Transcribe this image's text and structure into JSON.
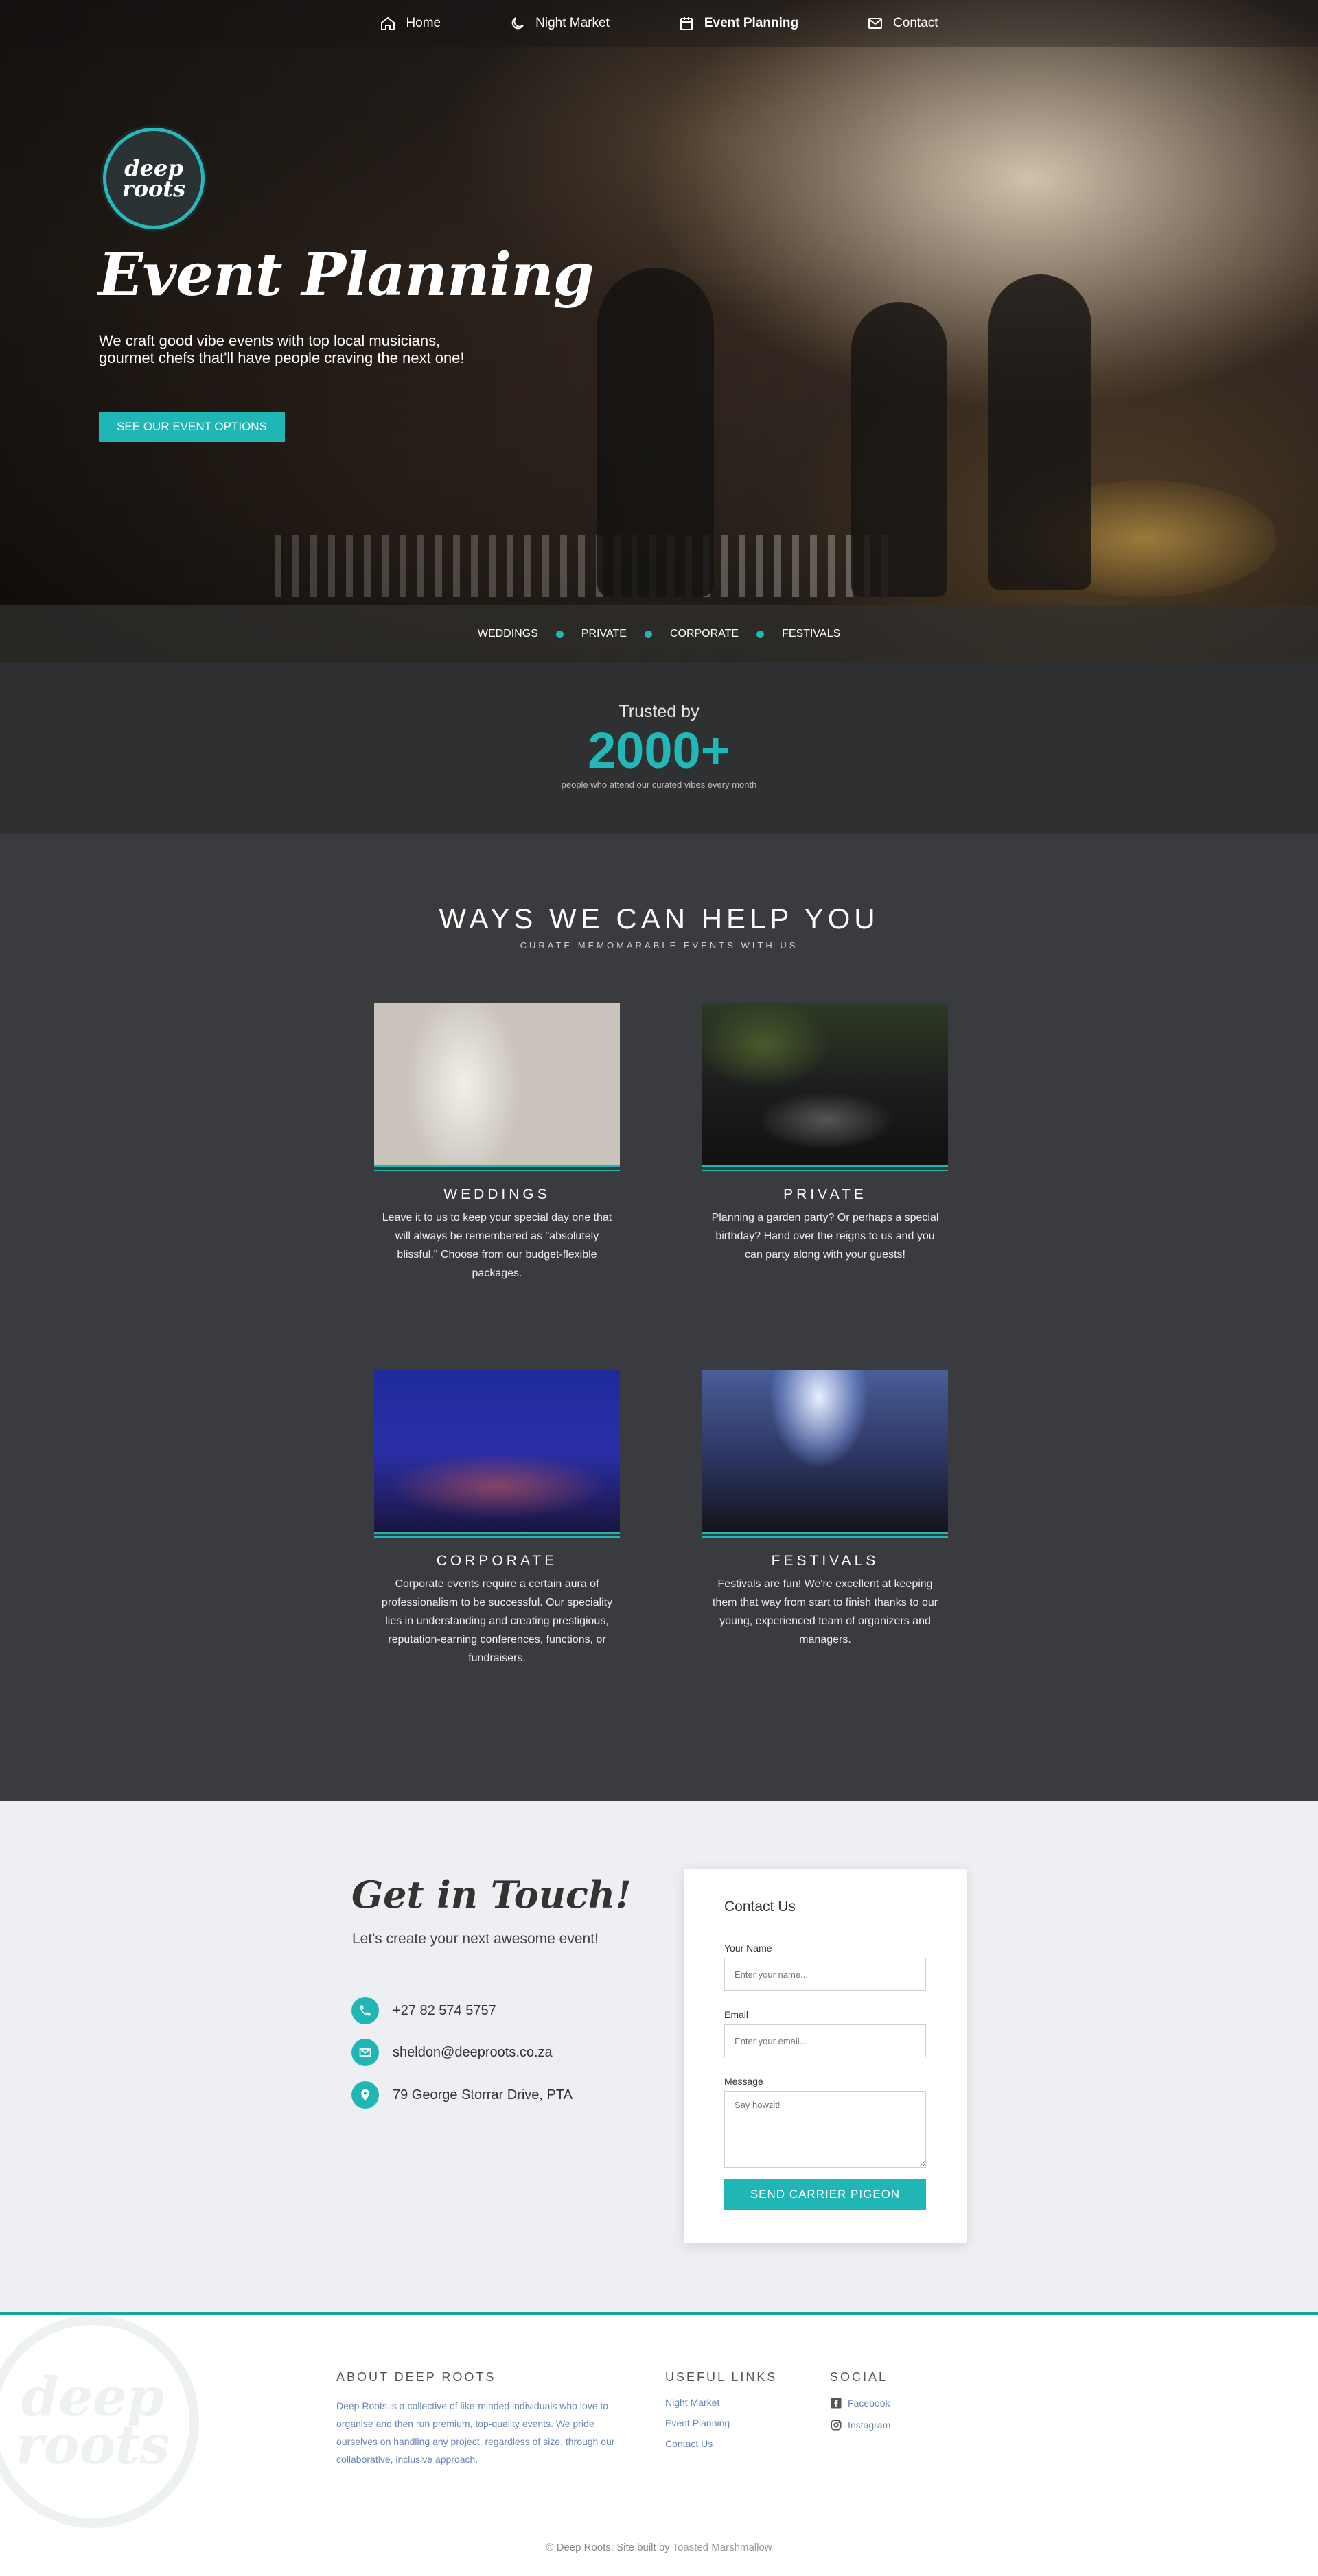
{
  "nav": {
    "items": [
      {
        "label": "Home"
      },
      {
        "label": "Night Market"
      },
      {
        "label": "Event Planning"
      },
      {
        "label": "Contact"
      }
    ]
  },
  "hero": {
    "logo_line1": "deep",
    "logo_line2": "roots",
    "title": "Event Planning",
    "subtitle": "We craft good vibe events with top local musicians, gourmet chefs that'll have people craving the next one!",
    "cta": "SEE OUR EVENT OPTIONS",
    "categories": [
      "WEDDINGS",
      "PRIVATE",
      "CORPORATE",
      "FESTIVALS"
    ]
  },
  "trusted": {
    "label": "Trusted by",
    "count": "2000+",
    "caption": "people who attend our curated vibes every month"
  },
  "ways": {
    "title": "WAYS WE CAN HELP YOU",
    "subtitle": "CURATE MEMOMARABLE EVENTS WITH US",
    "cards": [
      {
        "title": "WEDDINGS",
        "text": "Leave it to us to keep your special day one that will always be remembered as \"absolutely blissful.\" Choose from our budget-flexible packages."
      },
      {
        "title": "PRIVATE",
        "text": "Planning a garden party? Or perhaps a special birthday? Hand over the reigns to us and you can party along with your guests!"
      },
      {
        "title": "CORPORATE",
        "text": "Corporate events require a certain aura of professionalism to be successful. Our speciality lies in understanding and creating prestigious, reputation-earning conferences, functions, or fundraisers."
      },
      {
        "title": "FESTIVALS",
        "text": "Festivals are fun! We're excellent at keeping them that way from start to finish thanks to our young, experienced team of organizers and managers."
      }
    ]
  },
  "contact": {
    "title": "Get in Touch!",
    "subtitle": "Let's create your next awesome event!",
    "phone": "+27 82 574 5757",
    "email": "sheldon@deeproots.co.za",
    "address": "79 George Storrar Drive, PTA",
    "form": {
      "title": "Contact Us",
      "name_label": "Your Name",
      "name_placeholder": "Enter your name...",
      "email_label": "Email",
      "email_placeholder": "Enter your email...",
      "message_label": "Message",
      "message_placeholder": "Say howzit!",
      "submit": "SEND CARRIER PIGEON"
    }
  },
  "footer": {
    "watermark_line1": "deep",
    "watermark_line2": "roots",
    "about_title": "ABOUT DEEP ROOTS",
    "about_text": "Deep Roots is a collective of like-minded individuals who love to organise and then run premium, top-quality events. We pride ourselves on handling any project, regardless of size, through our collaborative, inclusive approach.",
    "links_title": "USEFUL LINKS",
    "links": [
      "Night Market",
      "Event Planning",
      "Contact Us"
    ],
    "social_title": "SOCIAL",
    "social": [
      "Facebook",
      "Instagram"
    ],
    "copyright": "© Deep Roots. Site built by",
    "builder": "Toasted Marshmallow"
  },
  "colors": {
    "accent": "#20b6b6",
    "dark": "#2f3032",
    "section": "#3a3b3e",
    "light": "#eeeff2"
  }
}
